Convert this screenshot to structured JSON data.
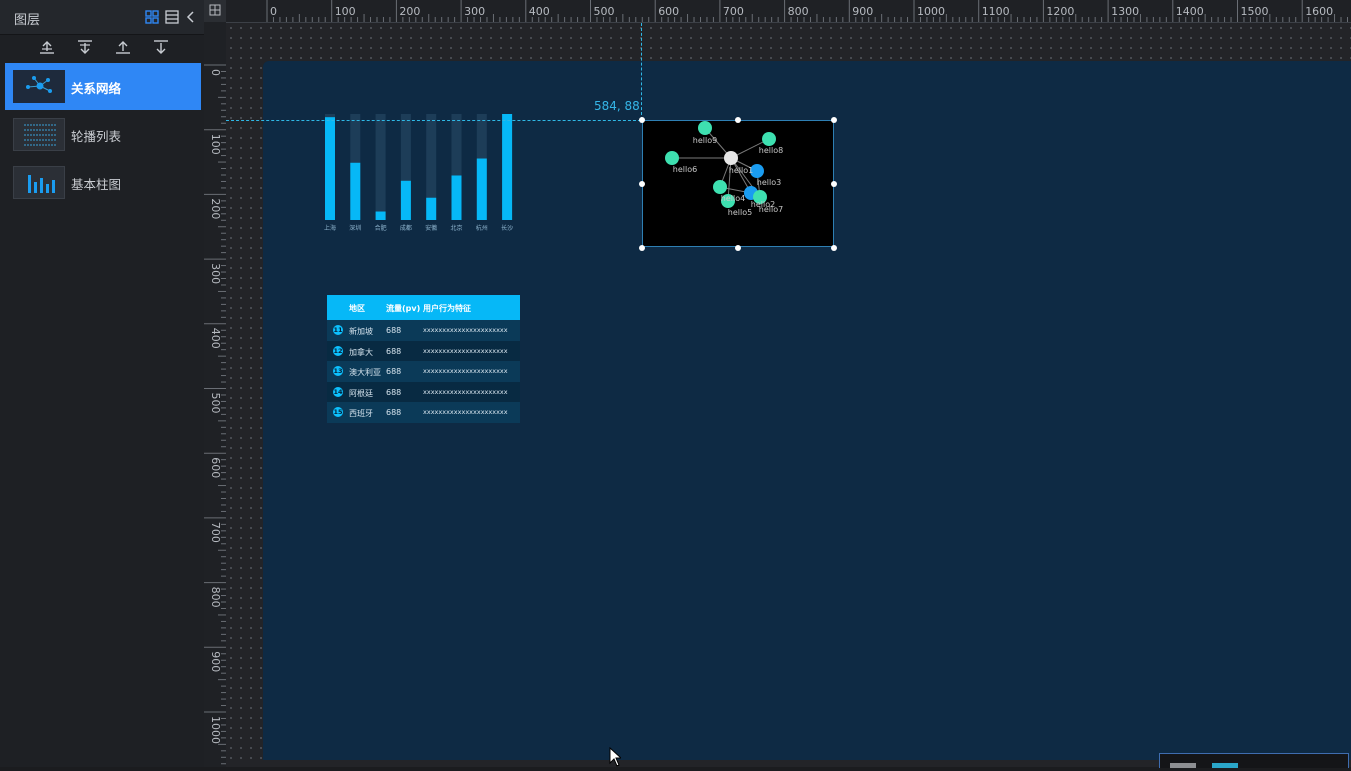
{
  "panel": {
    "title": "图层",
    "icons": [
      "grid-view-icon",
      "list-view-icon",
      "collapse-icon"
    ],
    "toolbar": [
      "move-top-icon",
      "move-bottom-icon",
      "move-up-icon",
      "move-down-icon"
    ],
    "layers": [
      {
        "label": "关系网络",
        "active": true,
        "icon": "network-thumb"
      },
      {
        "label": "轮播列表",
        "active": false,
        "icon": "list-thumb"
      },
      {
        "label": "基本柱图",
        "active": false,
        "icon": "bar-thumb"
      }
    ]
  },
  "ruler": {
    "top_labels": [
      "0",
      "100",
      "200",
      "300",
      "400",
      "500",
      "600",
      "700",
      "800",
      "900",
      "1000",
      "1100",
      "1200",
      "1300",
      "1400",
      "1500",
      "1600"
    ],
    "left_labels": [
      "0",
      "100",
      "200",
      "300",
      "400",
      "500",
      "600",
      "700",
      "800",
      "900",
      "1000"
    ]
  },
  "canvas": {
    "coord_readout": "584, 88",
    "background": "#0e2a44"
  },
  "bar_widget": {
    "categories": [
      "上海",
      "深圳",
      "合肥",
      "成都",
      "安徽",
      "北京",
      "杭州",
      "长沙"
    ],
    "values": [
      0.97,
      0.54,
      0.08,
      0.37,
      0.21,
      0.42,
      0.58,
      1.0
    ],
    "color": "#06b8f7"
  },
  "network_widget": {
    "nodes": [
      {
        "label": "hello9",
        "color": "#3ee0b0"
      },
      {
        "label": "hello8",
        "color": "#3ee0b0"
      },
      {
        "label": "hello6",
        "color": "#3ee0b0"
      },
      {
        "label": "hello1",
        "color": "#e6e6e6"
      },
      {
        "label": "hello3",
        "color": "#1a9cf0"
      },
      {
        "label": "hello4",
        "color": "#3ee0b0"
      },
      {
        "label": "hello2",
        "color": "#1a9cf0"
      },
      {
        "label": "hello5",
        "color": "#3ee0b0"
      },
      {
        "label": "hello7",
        "color": "#3ee0b0"
      }
    ]
  },
  "table_widget": {
    "headers": [
      "地区",
      "流量(pv)",
      "用户行为特征"
    ],
    "rows": [
      {
        "idx": "11",
        "region": "新加坡",
        "pv": "688",
        "feature": "xxxxxxxxxxxxxxxxxxxxxx"
      },
      {
        "idx": "12",
        "region": "加拿大",
        "pv": "688",
        "feature": "xxxxxxxxxxxxxxxxxxxxxx"
      },
      {
        "idx": "13",
        "region": "澳大利亚",
        "pv": "688",
        "feature": "xxxxxxxxxxxxxxxxxxxxxx"
      },
      {
        "idx": "14",
        "region": "阿根廷",
        "pv": "688",
        "feature": "xxxxxxxxxxxxxxxxxxxxxx"
      },
      {
        "idx": "15",
        "region": "西班牙",
        "pv": "688",
        "feature": "xxxxxxxxxxxxxxxxxxxxxx"
      }
    ]
  }
}
